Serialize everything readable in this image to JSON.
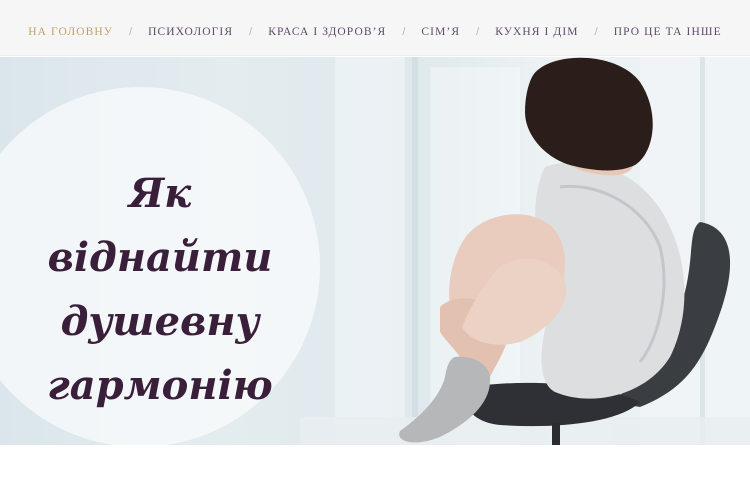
{
  "nav": {
    "items": [
      {
        "label": "НА ГОЛОВНУ",
        "active": true
      },
      {
        "label": "ПСИХОЛОГІЯ"
      },
      {
        "label": "КРАСА І ЗДОРОВ’Я"
      },
      {
        "label": "СІМ’Я"
      },
      {
        "label": "КУХНЯ І ДІМ"
      },
      {
        "label": "ПРО ЦЕ ТА ІНШЕ"
      }
    ],
    "separator": "/"
  },
  "hero": {
    "title_lines": [
      "Як",
      "віднайти",
      "душевну",
      "гармонію"
    ]
  },
  "colors": {
    "accent": "#c0a062",
    "nav_text": "#5d4a68",
    "title": "#3a1f3a"
  }
}
